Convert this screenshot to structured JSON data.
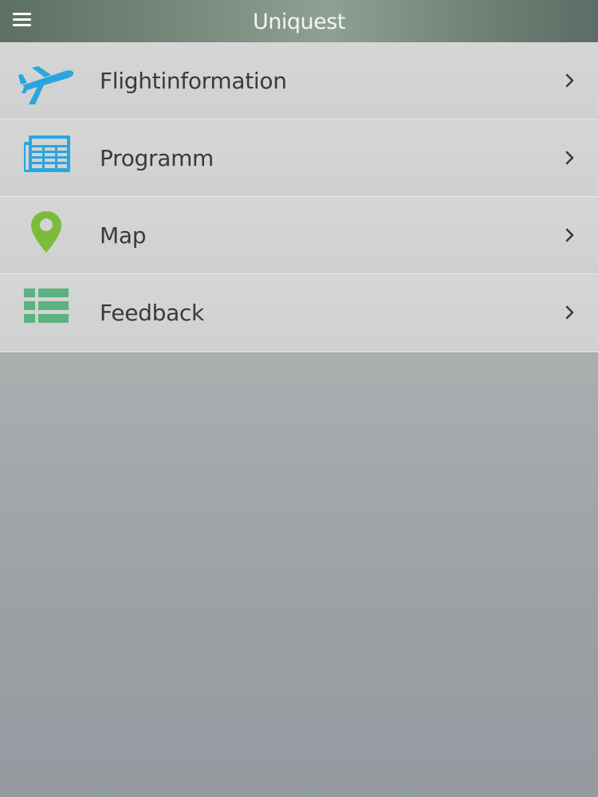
{
  "header": {
    "title": "Uniquest",
    "menu_icon": "hamburger-menu-icon"
  },
  "menu": {
    "items": [
      {
        "label": "Flightinformation",
        "icon": "airplane-icon",
        "icon_color": "#2aa6de"
      },
      {
        "label": "Programm",
        "icon": "newspaper-icon",
        "icon_color": "#2aa6de"
      },
      {
        "label": "Map",
        "icon": "map-pin-icon",
        "icon_color": "#7dbb3a"
      },
      {
        "label": "Feedback",
        "icon": "list-icon",
        "icon_color": "#5bb27e"
      }
    ],
    "chevron_icon": "chevron-right-icon"
  }
}
